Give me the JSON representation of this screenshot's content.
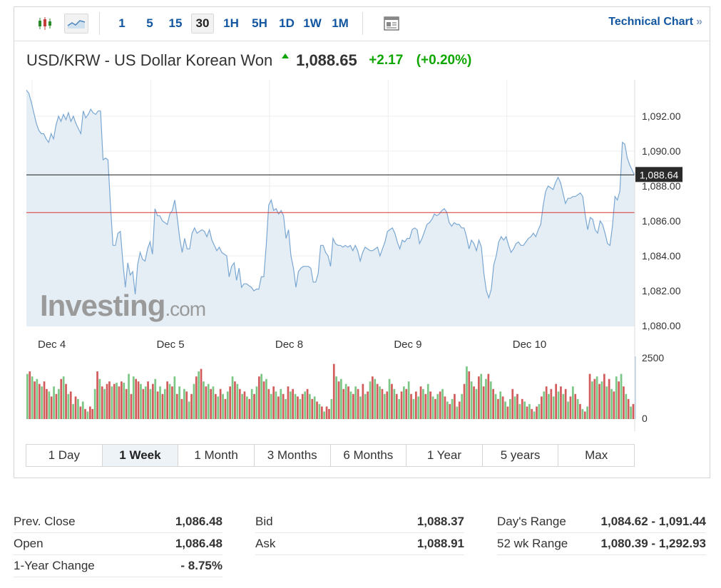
{
  "toolbar": {
    "intervals": [
      "1",
      "5",
      "15",
      "30",
      "1H",
      "5H",
      "1D",
      "1W",
      "1M"
    ],
    "active_interval": "30",
    "technical_chart": "Technical Chart",
    "chevron": "»"
  },
  "quote": {
    "title": "USD/KRW - US Dollar Korean Won",
    "last": "1,088.65",
    "change": "+2.17",
    "change_pct": "(+0.20%)",
    "direction": "up"
  },
  "colors": {
    "up_green": "#0ea600",
    "link_blue": "#1256a0",
    "line": "#7aa7d2",
    "area": "#e5eef5",
    "current_line": "#222222",
    "prev_close_line": "#d93434",
    "vol_up": "#7cc686",
    "vol_down": "#d25b5b"
  },
  "chart_data": {
    "type": "line",
    "y_axis": {
      "ticks": [
        "1,092.00",
        "1,090.00",
        "1,088.00",
        "1,086.00",
        "1,084.00",
        "1,082.00",
        "1,080.00"
      ],
      "ylim": [
        1080,
        1094
      ]
    },
    "x_axis": {
      "labels": [
        "Dec 4",
        "Dec 5",
        "Dec 8",
        "Dec 9",
        "Dec 10"
      ],
      "label_positions": [
        0,
        48,
        96,
        144,
        192
      ]
    },
    "current_marker": {
      "label": "1,088.64",
      "value": 1088.64
    },
    "prev_close_level": 1086.48,
    "watermark": {
      "brand": "Investing",
      "suffix": ".com"
    },
    "series_values": [
      1093.5,
      1093.3,
      1092.8,
      1092.2,
      1091.6,
      1091.2,
      1091.0,
      1091.0,
      1090.7,
      1090.5,
      1091.0,
      1090.7,
      1091.5,
      1092.0,
      1091.7,
      1092.1,
      1091.8,
      1092.2,
      1091.7,
      1092.0,
      1091.6,
      1091.3,
      1091.0,
      1092.3,
      1091.9,
      1092.1,
      1092.4,
      1092.2,
      1092.1,
      1092.3,
      1092.3,
      1089.5,
      1089.6,
      1089.5,
      1086.9,
      1084.6,
      1084.6,
      1085.3,
      1085.4,
      1083.7,
      1082.2,
      1083.6,
      1082.9,
      1083.1,
      1081.8,
      1083.5,
      1084.2,
      1083.8,
      1083.7,
      1084.4,
      1084.8,
      1084.1,
      1086.7,
      1086.3,
      1086.3,
      1086.0,
      1085.9,
      1085.8,
      1086.4,
      1086.6,
      1087.2,
      1086.2,
      1085.0,
      1084.2,
      1085.0,
      1084.4,
      1084.4,
      1085.3,
      1085.6,
      1085.3,
      1085.4,
      1085.5,
      1085.4,
      1085.1,
      1085.5,
      1084.9,
      1084.6,
      1084.3,
      1084.5,
      1084.2,
      1084.1,
      1084.0,
      1082.8,
      1083.4,
      1083.6,
      1082.6,
      1083.3,
      1082.2,
      1082.4,
      1082.4,
      1082.3,
      1082.2,
      1082.0,
      1082.1,
      1082.1,
      1082.8,
      1082.8,
      1084.6,
      1086.9,
      1087.2,
      1086.6,
      1086.7,
      1086.4,
      1086.6,
      1086.3,
      1085.0,
      1085.5,
      1084.0,
      1083.3,
      1082.2,
      1083.1,
      1083.3,
      1083.4,
      1083.4,
      1083.4,
      1083.3,
      1082.5,
      1082.5,
      1083.0,
      1084.6,
      1084.6,
      1084.2,
      1084.0,
      1083.4,
      1085.0,
      1084.7,
      1084.6,
      1084.6,
      1084.5,
      1084.6,
      1084.5,
      1084.6,
      1084.3,
      1084.6,
      1084.3,
      1083.7,
      1084.2,
      1084.5,
      1084.4,
      1084.3,
      1084.3,
      1084.4,
      1084.5,
      1084.0,
      1084.4,
      1084.8,
      1085.4,
      1085.5,
      1085.6,
      1085.3,
      1084.8,
      1084.4,
      1084.9,
      1084.8,
      1085.0,
      1085.0,
      1085.5,
      1085.6,
      1085.5,
      1084.7,
      1085.0,
      1085.4,
      1085.8,
      1085.9,
      1086.1,
      1086.4,
      1086.3,
      1086.4,
      1086.6,
      1086.7,
      1086.5,
      1085.9,
      1085.7,
      1085.9,
      1085.8,
      1085.8,
      1085.6,
      1085.6,
      1085.1,
      1084.4,
      1084.9,
      1084.7,
      1084.3,
      1084.9,
      1084.5,
      1083.0,
      1082.0,
      1081.6,
      1082.1,
      1083.5,
      1084.0,
      1084.8,
      1085.1,
      1084.9,
      1085.1,
      1084.6,
      1084.2,
      1084.4,
      1084.7,
      1084.8,
      1084.6,
      1084.6,
      1084.8,
      1085.0,
      1085.1,
      1085.3,
      1085.1,
      1085.5,
      1085.8,
      1086.9,
      1087.7,
      1088.0,
      1087.9,
      1087.8,
      1088.2,
      1088.5,
      1088.2,
      1087.6,
      1087.0,
      1087.3,
      1087.3,
      1087.4,
      1087.4,
      1087.5,
      1087.6,
      1087.4,
      1086.3,
      1085.5,
      1086.2,
      1086.1,
      1085.5,
      1085.3,
      1086.0,
      1085.8,
      1085.3,
      1084.7,
      1084.6,
      1085.7,
      1087.4,
      1087.2,
      1087.7,
      1090.5,
      1090.4,
      1089.6,
      1089.2,
      1088.9,
      1088.6
    ],
    "volume": {
      "ylim": [
        0,
        2500
      ],
      "ticks": [
        "2500",
        "0"
      ],
      "bars": [
        [
          1800,
          1
        ],
        [
          1900,
          0
        ],
        [
          1700,
          1
        ],
        [
          1500,
          0
        ],
        [
          1600,
          1
        ],
        [
          1400,
          0
        ],
        [
          1300,
          1
        ],
        [
          1500,
          0
        ],
        [
          1200,
          0
        ],
        [
          1100,
          1
        ],
        [
          900,
          0
        ],
        [
          1300,
          1
        ],
        [
          1000,
          0
        ],
        [
          1200,
          1
        ],
        [
          1600,
          0
        ],
        [
          1700,
          1
        ],
        [
          1400,
          0
        ],
        [
          1000,
          1
        ],
        [
          1100,
          0
        ],
        [
          600,
          1
        ],
        [
          900,
          0
        ],
        [
          800,
          1
        ],
        [
          500,
          0
        ],
        [
          700,
          1
        ],
        [
          400,
          0
        ],
        [
          300,
          1
        ],
        [
          500,
          0
        ],
        [
          400,
          0
        ],
        [
          1200,
          1
        ],
        [
          1900,
          0
        ],
        [
          1600,
          1
        ],
        [
          1300,
          0
        ],
        [
          1200,
          1
        ],
        [
          1400,
          0
        ],
        [
          1500,
          0
        ],
        [
          1300,
          1
        ],
        [
          1400,
          0
        ],
        [
          1450,
          1
        ],
        [
          1300,
          0
        ],
        [
          1500,
          0
        ],
        [
          1450,
          1
        ],
        [
          1200,
          0
        ],
        [
          1800,
          1
        ],
        [
          1000,
          0
        ],
        [
          1700,
          1
        ],
        [
          1600,
          0
        ],
        [
          1500,
          0
        ],
        [
          1400,
          1
        ],
        [
          1200,
          0
        ],
        [
          1300,
          1
        ],
        [
          1500,
          0
        ],
        [
          1200,
          1
        ],
        [
          1400,
          0
        ],
        [
          1600,
          1
        ],
        [
          1100,
          0
        ],
        [
          1300,
          1
        ],
        [
          1000,
          0
        ],
        [
          1200,
          1
        ],
        [
          1500,
          0
        ],
        [
          1400,
          1
        ],
        [
          1300,
          0
        ],
        [
          1700,
          1
        ],
        [
          1000,
          0
        ],
        [
          1300,
          1
        ],
        [
          800,
          0
        ],
        [
          1200,
          1
        ],
        [
          1100,
          0
        ],
        [
          700,
          1
        ],
        [
          1000,
          0
        ],
        [
          1400,
          1
        ],
        [
          1700,
          0
        ],
        [
          1900,
          1
        ],
        [
          2000,
          0
        ],
        [
          1500,
          1
        ],
        [
          1300,
          0
        ],
        [
          1400,
          1
        ],
        [
          1200,
          0
        ],
        [
          1300,
          1
        ],
        [
          1000,
          0
        ],
        [
          900,
          1
        ],
        [
          1200,
          0
        ],
        [
          1000,
          1
        ],
        [
          800,
          0
        ],
        [
          1100,
          1
        ],
        [
          1300,
          0
        ],
        [
          1700,
          1
        ],
        [
          1500,
          0
        ],
        [
          1400,
          1
        ],
        [
          1200,
          0
        ],
        [
          1000,
          1
        ],
        [
          1100,
          0
        ],
        [
          900,
          1
        ],
        [
          800,
          0
        ],
        [
          1200,
          1
        ],
        [
          1000,
          0
        ],
        [
          1300,
          1
        ],
        [
          1700,
          0
        ],
        [
          1800,
          1
        ],
        [
          1500,
          0
        ],
        [
          1600,
          1
        ],
        [
          1200,
          0
        ],
        [
          1000,
          1
        ],
        [
          1300,
          0
        ],
        [
          1100,
          1
        ],
        [
          900,
          0
        ],
        [
          1200,
          1
        ],
        [
          1000,
          0
        ],
        [
          800,
          1
        ],
        [
          1300,
          0
        ],
        [
          1100,
          1
        ],
        [
          1200,
          0
        ],
        [
          1000,
          1
        ],
        [
          900,
          0
        ],
        [
          800,
          1
        ],
        [
          1000,
          0
        ],
        [
          1100,
          1
        ],
        [
          1200,
          0
        ],
        [
          1000,
          1
        ],
        [
          800,
          0
        ],
        [
          900,
          1
        ],
        [
          700,
          0
        ],
        [
          600,
          1
        ],
        [
          500,
          0
        ],
        [
          300,
          1
        ],
        [
          500,
          0
        ],
        [
          400,
          0
        ],
        [
          800,
          1
        ],
        [
          2200,
          0
        ],
        [
          1700,
          1
        ],
        [
          1500,
          0
        ],
        [
          1600,
          1
        ],
        [
          1200,
          0
        ],
        [
          1400,
          1
        ],
        [
          1300,
          0
        ],
        [
          1100,
          1
        ],
        [
          1000,
          0
        ],
        [
          1300,
          1
        ],
        [
          1200,
          0
        ],
        [
          900,
          1
        ],
        [
          1400,
          0
        ],
        [
          1000,
          1
        ],
        [
          1100,
          0
        ],
        [
          1500,
          1
        ],
        [
          1700,
          0
        ],
        [
          1600,
          1
        ],
        [
          1400,
          0
        ],
        [
          1300,
          1
        ],
        [
          1200,
          0
        ],
        [
          1000,
          1
        ],
        [
          1100,
          0
        ],
        [
          1600,
          1
        ],
        [
          1400,
          0
        ],
        [
          1200,
          1
        ],
        [
          1000,
          0
        ],
        [
          800,
          1
        ],
        [
          1100,
          0
        ],
        [
          1300,
          1
        ],
        [
          1200,
          0
        ],
        [
          1500,
          1
        ],
        [
          1000,
          0
        ],
        [
          800,
          1
        ],
        [
          1100,
          0
        ],
        [
          900,
          1
        ],
        [
          1300,
          0
        ],
        [
          1200,
          1
        ],
        [
          1000,
          0
        ],
        [
          1400,
          1
        ],
        [
          1100,
          0
        ],
        [
          900,
          1
        ],
        [
          800,
          0
        ],
        [
          1000,
          1
        ],
        [
          1100,
          0
        ],
        [
          1200,
          1
        ],
        [
          900,
          0
        ],
        [
          700,
          1
        ],
        [
          600,
          0
        ],
        [
          800,
          1
        ],
        [
          1000,
          0
        ],
        [
          500,
          1
        ],
        [
          700,
          0
        ],
        [
          1000,
          1
        ],
        [
          1400,
          0
        ],
        [
          2100,
          1
        ],
        [
          1900,
          0
        ],
        [
          1500,
          1
        ],
        [
          1300,
          0
        ],
        [
          1200,
          1
        ],
        [
          1700,
          0
        ],
        [
          1800,
          1
        ],
        [
          1300,
          0
        ],
        [
          1600,
          1
        ],
        [
          1800,
          0
        ],
        [
          1500,
          1
        ],
        [
          1200,
          0
        ],
        [
          1000,
          1
        ],
        [
          800,
          0
        ],
        [
          1100,
          1
        ],
        [
          900,
          0
        ],
        [
          700,
          1
        ],
        [
          500,
          0
        ],
        [
          800,
          1
        ],
        [
          1200,
          0
        ],
        [
          900,
          1
        ],
        [
          1000,
          0
        ],
        [
          600,
          1
        ],
        [
          800,
          0
        ],
        [
          700,
          1
        ],
        [
          500,
          0
        ],
        [
          600,
          1
        ],
        [
          400,
          0
        ],
        [
          300,
          1
        ],
        [
          500,
          0
        ],
        [
          600,
          1
        ],
        [
          900,
          0
        ],
        [
          1100,
          1
        ],
        [
          1300,
          0
        ],
        [
          1000,
          1
        ],
        [
          1200,
          0
        ],
        [
          900,
          1
        ],
        [
          1400,
          0
        ],
        [
          1100,
          1
        ],
        [
          1300,
          0
        ],
        [
          1000,
          1
        ],
        [
          1200,
          0
        ],
        [
          700,
          1
        ],
        [
          900,
          0
        ],
        [
          1300,
          1
        ],
        [
          1000,
          0
        ],
        [
          800,
          1
        ],
        [
          600,
          0
        ],
        [
          400,
          1
        ],
        [
          300,
          0
        ],
        [
          500,
          1
        ],
        [
          1800,
          0
        ],
        [
          1500,
          1
        ],
        [
          1600,
          0
        ],
        [
          1700,
          1
        ],
        [
          1400,
          0
        ],
        [
          1500,
          1
        ],
        [
          1800,
          0
        ],
        [
          1300,
          1
        ],
        [
          1600,
          0
        ],
        [
          1200,
          1
        ],
        [
          1100,
          0
        ],
        [
          1700,
          1
        ],
        [
          1500,
          0
        ],
        [
          1800,
          1
        ],
        [
          1300,
          0
        ],
        [
          1000,
          1
        ],
        [
          800,
          0
        ],
        [
          500,
          1
        ],
        [
          600,
          0
        ]
      ]
    }
  },
  "range_tabs": [
    "1 Day",
    "1 Week",
    "1 Month",
    "3 Months",
    "6 Months",
    "1 Year",
    "5 years",
    "Max"
  ],
  "active_range": "1 Week",
  "stats": {
    "col1": [
      {
        "label": "Prev. Close",
        "value": "1,086.48"
      },
      {
        "label": "Open",
        "value": "1,086.48"
      },
      {
        "label": "1-Year Change",
        "value": "- 8.75%"
      }
    ],
    "col2": [
      {
        "label": "Bid",
        "value": "1,088.37"
      },
      {
        "label": "Ask",
        "value": "1,088.91"
      }
    ],
    "col3": [
      {
        "label": "Day's Range",
        "value": "1,084.62 - 1,091.44"
      },
      {
        "label": "52 wk Range",
        "value": "1,080.39 - 1,292.93"
      }
    ]
  }
}
